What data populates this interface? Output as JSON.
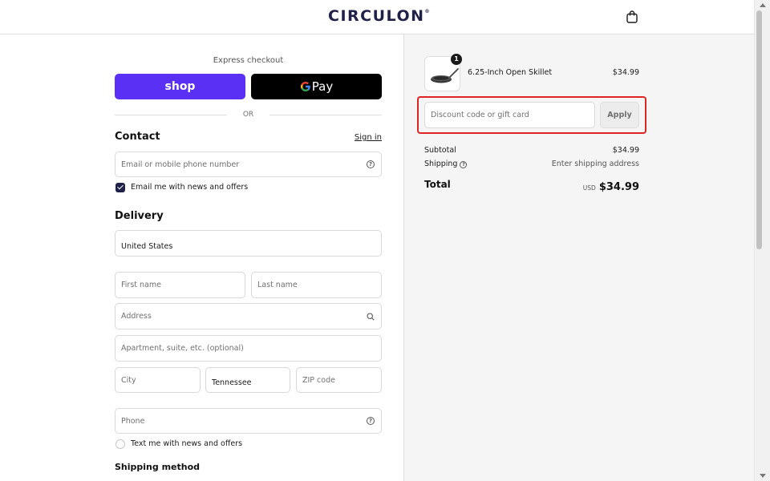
{
  "header": {
    "logo_text": "CIRCULON",
    "logo_mark": "®",
    "cart_icon": "shopping-bag-icon"
  },
  "express": {
    "label": "Express checkout",
    "shop_label": "shop",
    "gpay_label": "Pay",
    "or_label": "OR"
  },
  "contact": {
    "title": "Contact",
    "signin_label": "Sign in",
    "email_placeholder": "Email or mobile phone number",
    "newsletter_label": "Email me with news and offers",
    "newsletter_checked": true
  },
  "delivery": {
    "title": "Delivery",
    "country_value": "United States",
    "first_name_placeholder": "First name",
    "last_name_placeholder": "Last name",
    "address_placeholder": "Address",
    "apartment_placeholder": "Apartment, suite, etc. (optional)",
    "city_placeholder": "City",
    "state_value": "Tennessee",
    "zip_placeholder": "ZIP code",
    "phone_placeholder": "Phone",
    "sms_label": "Text me with news and offers",
    "sms_checked": false
  },
  "shipping_method": {
    "title": "Shipping method"
  },
  "summary": {
    "item": {
      "quantity": "1",
      "name": "6.25-Inch Open Skillet",
      "price": "$34.99"
    },
    "discount_placeholder": "Discount code or gift card",
    "apply_label": "Apply",
    "subtotal_label": "Subtotal",
    "subtotal_value": "$34.99",
    "shipping_label": "Shipping",
    "shipping_value": "Enter shipping address",
    "total_label": "Total",
    "total_currency": "USD",
    "total_value": "$34.99"
  },
  "colors": {
    "shop_pay": "#5a31f4",
    "brand_navy": "#1f2146",
    "highlight": "#e02424"
  }
}
